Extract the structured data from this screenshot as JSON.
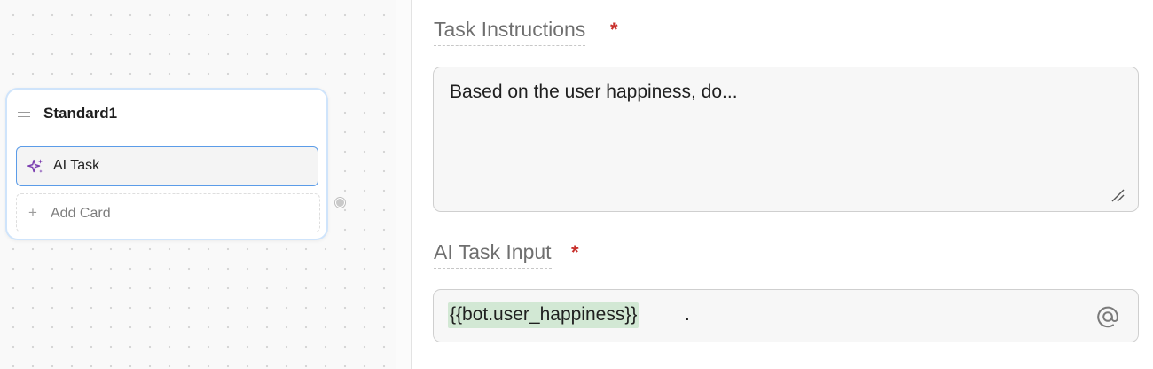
{
  "canvas": {
    "node": {
      "title": "Standard1",
      "cards": [
        {
          "label": "AI Task",
          "icon": "sparkle-icon",
          "selected": true
        }
      ],
      "add_card_label": "Add Card"
    }
  },
  "form": {
    "task_instructions": {
      "label": "Task Instructions",
      "required_mark": "*",
      "value": "Based on the user happiness, do..."
    },
    "ai_task_input": {
      "label": "AI Task Input",
      "required_mark": "*",
      "token": "{{bot.user_happiness}}",
      "suffix": "."
    }
  },
  "colors": {
    "accent_blue": "#5b9ce8",
    "required_red": "#c8302c",
    "token_green": "#d2e8d4",
    "sparkle_purple": "#7b3fb0"
  }
}
